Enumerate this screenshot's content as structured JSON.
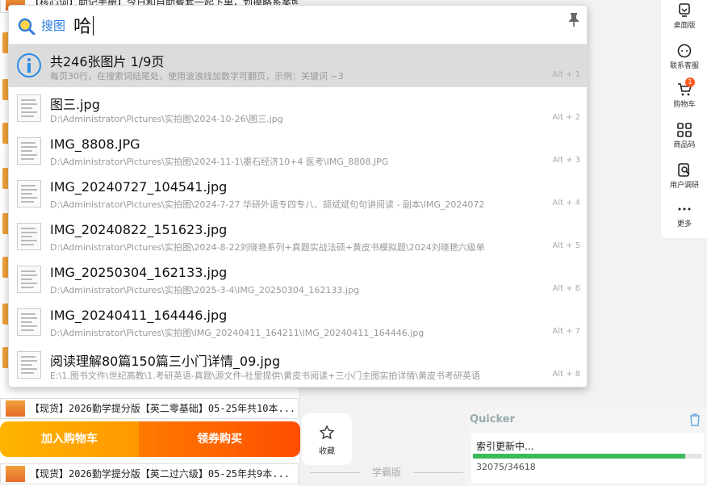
{
  "background": {
    "rows": [
      "【核心词】助记手册】今日和自助餐套一起下单，划掉略系案照手册全部全送",
      "【现货】2026勤学提分版【英二零基础】05-25年共10本...",
      "【现货】2026勤学提分版【英二过六级】05-25年共9本..."
    ]
  },
  "sidebar": {
    "items": [
      {
        "label": "桌面版",
        "icon": "desktop-icon"
      },
      {
        "label": "联系客服",
        "icon": "chat-icon"
      },
      {
        "label": "购物车",
        "icon": "cart-icon",
        "badge": "1"
      },
      {
        "label": "商品码",
        "icon": "qrcode-icon"
      },
      {
        "label": "用户调研",
        "icon": "survey-icon"
      },
      {
        "label": "更多",
        "icon": "more-icon"
      }
    ]
  },
  "bottom": {
    "cart_label": "加入购物车",
    "buy_label": "领券购买",
    "fav_label": "收藏",
    "footer_label": "学霸版"
  },
  "quicker": {
    "title": "Quicker",
    "status": "索引更新中...",
    "count": "32075/34618",
    "progress": 0.927,
    "accent": "#3cb95a"
  },
  "search": {
    "label": "搜图",
    "query": "哈",
    "accent": "#2b7be0",
    "results": [
      {
        "title": "共246张图片   1/9页",
        "sub": "每页30行，在搜索词结尾处，使用波浪线加数字可翻页，示例：关键词 ~3",
        "key": "Alt + 1",
        "icon": "info-icon"
      },
      {
        "title": "图三.jpg",
        "sub": "D:\\Administrator\\Pictures\\实拍图\\2024-10-26\\图三.jpg",
        "key": "Alt + 2",
        "icon": "image-thumbnail-icon"
      },
      {
        "title": "IMG_8808.JPG",
        "sub": "D:\\Administrator\\Pictures\\实拍图\\2024-11-1\\墨石经济10+4  医考\\IMG_8808.JPG",
        "key": "Alt + 3",
        "icon": "image-thumbnail-icon"
      },
      {
        "title": "IMG_20240727_104541.jpg",
        "sub": "D:\\Administrator\\Pictures\\实拍图\\2024-7-27 华研外语专四专八、颉斌斌句句讲阅读 - 副本\\IMG_2024072",
        "key": "Alt + 4",
        "icon": "image-thumbnail-icon"
      },
      {
        "title": "IMG_20240822_151623.jpg",
        "sub": "D:\\Administrator\\Pictures\\实拍图\\2024-8-22刘晓艳系列+真题实战法硕+黄皮书模拟题\\2024刘晓艳六级单",
        "key": "Alt + 5",
        "icon": "image-thumbnail-icon"
      },
      {
        "title": "IMG_20250304_162133.jpg",
        "sub": "D:\\Administrator\\Pictures\\实拍图\\2025-3-4\\IMG_20250304_162133.jpg",
        "key": "Alt + 6",
        "icon": "image-thumbnail-icon"
      },
      {
        "title": "IMG_20240411_164446.jpg",
        "sub": "D:\\Administrator\\Pictures\\实拍图\\IMG_20240411_164211\\IMG_20240411_164446.jpg",
        "key": "Alt + 7",
        "icon": "image-thumbnail-icon"
      },
      {
        "title": "阅读理解80篇150篇三小门详情_09.jpg",
        "sub": "E:\\1.图书文件\\世纪高教\\1.考研英语-真题\\源文件-社里提供\\黄皮书阅读+三小门主图实拍详情\\黄皮书考研英语",
        "key": "Alt + 8",
        "icon": "image-thumbnail-icon"
      }
    ]
  }
}
